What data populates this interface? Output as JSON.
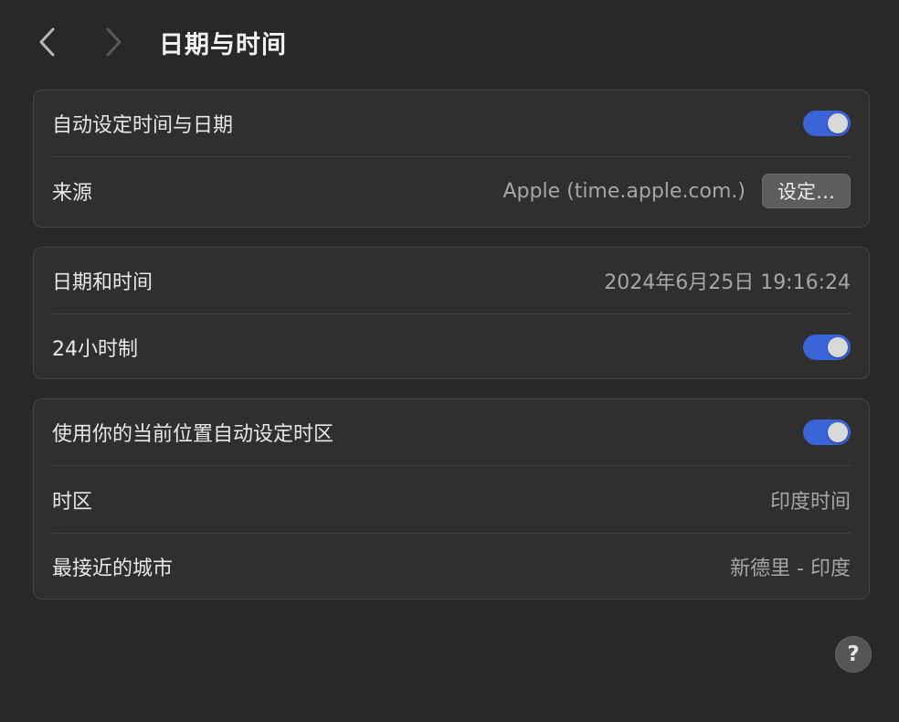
{
  "header": {
    "title": "日期与时间",
    "back_icon": "chevron-left-icon",
    "forward_icon": "chevron-right-icon"
  },
  "sync_card": {
    "auto_set_label": "自动设定时间与日期",
    "auto_set_enabled": true,
    "source_label": "来源",
    "source_value": "Apple (time.apple.com.)",
    "source_button": "设定…"
  },
  "datetime_card": {
    "datetime_label": "日期和时间",
    "datetime_value": "2024年6月25日 19:16:24",
    "hour24_label": "24小时制",
    "hour24_enabled": true
  },
  "timezone_card": {
    "auto_tz_label": "使用你的当前位置自动设定时区",
    "auto_tz_enabled": true,
    "timezone_label": "时区",
    "timezone_value": "印度时间",
    "city_label": "最接近的城市",
    "city_value": "新德里 - 印度"
  },
  "help": {
    "label": "?"
  },
  "colors": {
    "background": "#282828",
    "card": "#2f2f2f",
    "accent": "#3a64d8",
    "secondary_text": "#a6a6a6"
  }
}
